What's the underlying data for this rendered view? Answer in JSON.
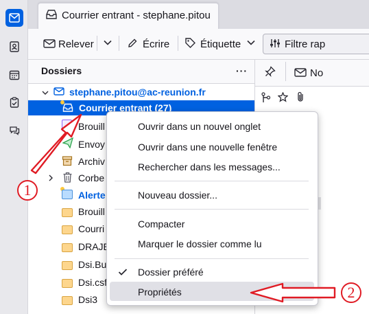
{
  "tab": {
    "title": "Courrier entrant - stephane.pitou"
  },
  "toolbar": {
    "get_mail": "Relever",
    "write": "Écrire",
    "tag": "Étiquette",
    "filter": "Filtre rap"
  },
  "folder_pane": {
    "title": "Dossiers",
    "account": "stephane.pitou@ac-reunion.fr",
    "selected_folder": "Courrier entrant (27)",
    "folders": [
      "Brouill",
      "Envoy",
      "Archiv",
      "Corbe",
      "Alerte",
      "Brouill",
      "Courri",
      "DRAJE",
      "Dsi.Bu",
      "Dsi.csf",
      "Dsi3"
    ]
  },
  "message_pane": {
    "column_label": "No"
  },
  "context_menu": {
    "items": [
      "Ouvrir dans un nouvel onglet",
      "Ouvrir dans une nouvelle fenêtre",
      "Rechercher dans les messages...",
      "Nouveau dossier...",
      "Compacter",
      "Marquer le dossier comme lu",
      "Dossier préféré",
      "Propriétés"
    ]
  },
  "annotations": {
    "step1": "1",
    "step2": "2"
  },
  "colors": {
    "accent": "#0061e0",
    "annotation": "#e01b24",
    "folder": "#fdd68d"
  }
}
